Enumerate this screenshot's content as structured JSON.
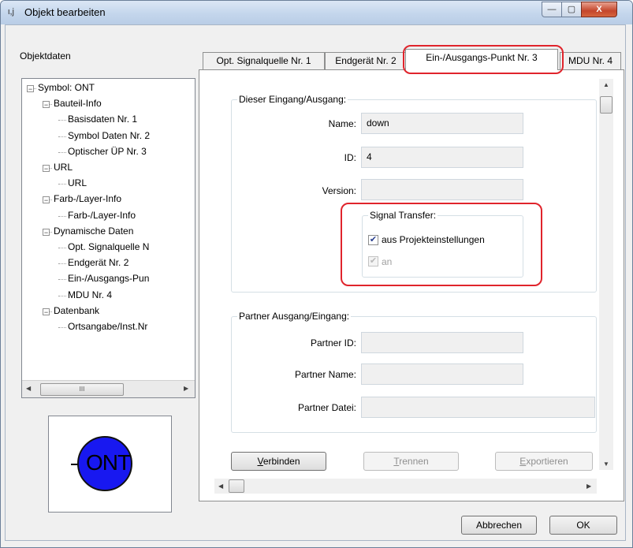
{
  "window": {
    "icon_text": "ι,ϳ",
    "title": "Objekt bearbeiten",
    "minimize_glyph": "—",
    "maximize_glyph": "▢",
    "close_glyph": "X"
  },
  "left": {
    "section_label": "Objektdaten",
    "tree": [
      {
        "label": "Symbol: ONT",
        "level": 0,
        "toggle": "−"
      },
      {
        "label": "Bauteil-Info",
        "level": 1,
        "toggle": "−"
      },
      {
        "label": "Basisdaten Nr. 1",
        "level": 2
      },
      {
        "label": "Symbol Daten Nr. 2",
        "level": 2
      },
      {
        "label": "Optischer ÜP Nr. 3",
        "level": 2
      },
      {
        "label": "URL",
        "level": 1,
        "toggle": "−"
      },
      {
        "label": "URL",
        "level": 2
      },
      {
        "label": "Farb-/Layer-Info",
        "level": 1,
        "toggle": "−"
      },
      {
        "label": "Farb-/Layer-Info",
        "level": 2
      },
      {
        "label": "Dynamische Daten",
        "level": 1,
        "toggle": "−"
      },
      {
        "label": "Opt. Signalquelle N",
        "level": 2
      },
      {
        "label": "Endgerät Nr. 2",
        "level": 2
      },
      {
        "label": "Ein-/Ausgangs-Pun",
        "level": 2
      },
      {
        "label": "MDU Nr. 4",
        "level": 2
      },
      {
        "label": "Datenbank",
        "level": 1,
        "toggle": "−"
      },
      {
        "label": "Ortsangabe/Inst.Nr",
        "level": 2
      }
    ],
    "scroll_thumb_glyph": "III",
    "preview_symbol_text": "ONT"
  },
  "tabs": [
    {
      "label": "Opt. Signalquelle Nr. 1",
      "active": false
    },
    {
      "label": "Endgerät Nr. 2",
      "active": false
    },
    {
      "label": "Ein-/Ausgangs-Punkt Nr. 3",
      "active": true
    },
    {
      "label": "MDU Nr. 4",
      "active": false
    }
  ],
  "io_group": {
    "title": "Dieser Eingang/Ausgang:",
    "name_label": "Name:",
    "name_value": "down",
    "id_label": "ID:",
    "id_value": "4",
    "version_label": "Version:",
    "version_value": "",
    "signal_transfer": {
      "title": "Signal Transfer:",
      "project_settings_label": "aus Projekteinstellungen",
      "project_settings_checked": true,
      "on_label": "an",
      "on_checked": true,
      "on_disabled": true
    }
  },
  "partner_group": {
    "title": "Partner Ausgang/Eingang:",
    "id_label": "Partner ID:",
    "id_value": "",
    "name_label": "Partner Name:",
    "name_value": "",
    "file_label": "Partner Datei:",
    "file_value": ""
  },
  "actions": {
    "connect": {
      "underline": "V",
      "rest": "erbinden"
    },
    "disconnect": {
      "underline": "T",
      "rest": "rennen"
    },
    "export": {
      "underline": "E",
      "rest": "xportieren"
    }
  },
  "footer": {
    "cancel_label": "Abbrechen",
    "ok_label": "OK"
  },
  "colors": {
    "annotation": "#e0242c",
    "symbol_fill": "#1818f0"
  }
}
